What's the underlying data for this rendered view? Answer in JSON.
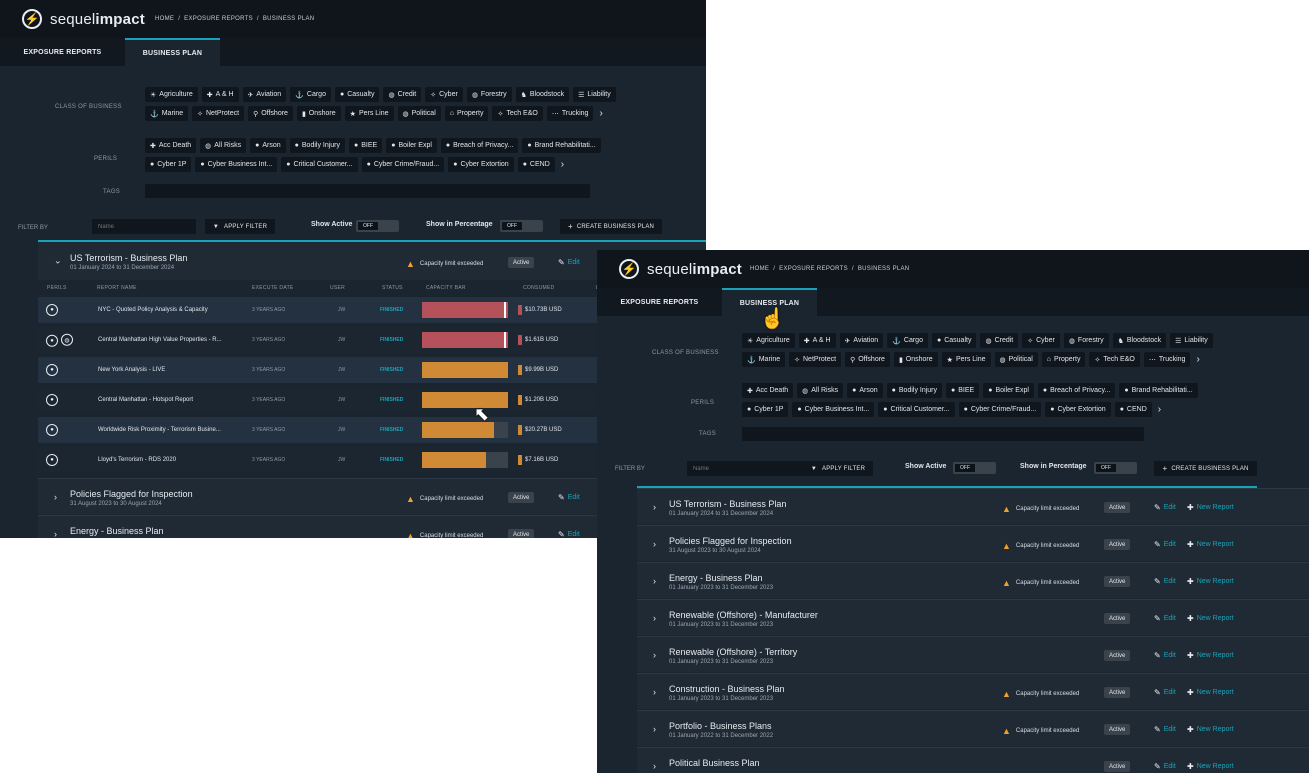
{
  "app": {
    "logo_glyph": "⚡",
    "logo_light": "sequel",
    "logo_bold": "impact",
    "breadcrumb": [
      "HOME",
      "/",
      "EXPOSURE REPORTS",
      "/",
      "BUSINESS PLAN"
    ]
  },
  "tabs": {
    "exposure": "EXPOSURE REPORTS",
    "business": "BUSINESS PLAN"
  },
  "filters": {
    "class_label": "CLASS OF BUSINESS",
    "perils_label": "PERILS",
    "tags_label": "TAGS",
    "classes": [
      {
        "icon": "☀",
        "label": "Agriculture"
      },
      {
        "icon": "✚",
        "label": "A & H"
      },
      {
        "icon": "✈",
        "label": "Aviation"
      },
      {
        "icon": "⚓",
        "label": "Cargo"
      },
      {
        "icon": "●",
        "label": "Casualty"
      },
      {
        "icon": "◍",
        "label": "Credit"
      },
      {
        "icon": "✧",
        "label": "Cyber"
      },
      {
        "icon": "◍",
        "label": "Forestry"
      },
      {
        "icon": "♞",
        "label": "Bloodstock"
      },
      {
        "icon": "☰",
        "label": "Liability"
      },
      {
        "icon": "⚓",
        "label": "Marine"
      },
      {
        "icon": "✧",
        "label": "NetProtect"
      },
      {
        "icon": "⚲",
        "label": "Offshore"
      },
      {
        "icon": "▮",
        "label": "Onshore"
      },
      {
        "icon": "★",
        "label": "Pers Line"
      },
      {
        "icon": "◍",
        "label": "Political"
      },
      {
        "icon": "⌂",
        "label": "Property"
      },
      {
        "icon": "✧",
        "label": "Tech E&O"
      },
      {
        "icon": "⋯",
        "label": "Trucking"
      }
    ],
    "perils": [
      {
        "icon": "✚",
        "label": "Acc Death"
      },
      {
        "icon": "◍",
        "label": "All Risks"
      },
      {
        "icon": "●",
        "label": "Arson"
      },
      {
        "icon": "●",
        "label": "Bodily Injury"
      },
      {
        "icon": "●",
        "label": "BIEE"
      },
      {
        "icon": "●",
        "label": "Boiler Expl"
      },
      {
        "icon": "●",
        "label": "Breach of Privacy..."
      },
      {
        "icon": "●",
        "label": "Brand Rehabilitati..."
      },
      {
        "icon": "●",
        "label": "Cyber 1P"
      },
      {
        "icon": "●",
        "label": "Cyber Business Int..."
      },
      {
        "icon": "●",
        "label": "Critical Customer..."
      },
      {
        "icon": "●",
        "label": "Cyber Crime/Fraud..."
      },
      {
        "icon": "●",
        "label": "Cyber Extortion"
      },
      {
        "icon": "●",
        "label": "CEND"
      }
    ],
    "more_glyph": "›"
  },
  "filterbar": {
    "filter_by": "FILTER BY",
    "name_placeholder": "Name",
    "apply": "APPLY FILTER",
    "show_active": "Show Active",
    "show_pct": "Show in Percentage",
    "off": "OFF",
    "create": "CREATE BUSINESS PLAN",
    "filter_glyph": "▼",
    "plus_glyph": "+"
  },
  "labels": {
    "capacity_exceeded": "Capacity limit exceeded",
    "active": "Active",
    "edit": "Edit",
    "new_report": "New Report",
    "warn_glyph": "▲",
    "edit_glyph": "✎",
    "plus_glyph": "✚",
    "chev_right": "›",
    "chev_down": "⌄"
  },
  "table": {
    "headers": [
      "PERILS",
      "REPORT NAME",
      "EXECUTE DATE",
      "USER",
      "STATUS",
      "CAPACITY BAR",
      "CONSUMED",
      "L"
    ],
    "rows": [
      {
        "name": "NYC - Quoted Policy Analysis & Capacity",
        "date": "3 YEARS AGO",
        "user": "JW",
        "status": "FINISHED",
        "consumed": "$10.73B USD",
        "fill": 1.0,
        "color": "#b5515b",
        "mark": 0.95,
        "perils": [
          "●"
        ]
      },
      {
        "name": "Central Manhattan High Value Properties - R...",
        "date": "3 YEARS AGO",
        "user": "JW",
        "status": "FINISHED",
        "consumed": "$1.61B USD",
        "fill": 1.0,
        "color": "#b5515b",
        "mark": 0.95,
        "perils": [
          "●",
          "◍"
        ]
      },
      {
        "name": "New York Analysis - LIVE",
        "date": "3 YEARS AGO",
        "user": "JW",
        "status": "FINISHED",
        "consumed": "$9.99B USD",
        "fill": 1.0,
        "color": "#d08a35",
        "mark": null,
        "perils": [
          "●"
        ]
      },
      {
        "name": "Central Manhattan - Hotspot Report",
        "date": "3 YEARS AGO",
        "user": "JW",
        "status": "FINISHED",
        "consumed": "$1.20B USD",
        "fill": 1.0,
        "color": "#d08a35",
        "mark": null,
        "perils": [
          "●"
        ]
      },
      {
        "name": "Worldwide Risk Proximity - Terrorism Busine...",
        "date": "3 YEARS AGO",
        "user": "JW",
        "status": "FINISHED",
        "consumed": "$20.27B USD",
        "fill": 0.84,
        "color": "#d08a35",
        "mark": null,
        "perils": [
          "●"
        ]
      },
      {
        "name": "Lloyd's Terrorism - RDS 2020",
        "date": "3 YEARS AGO",
        "user": "JW",
        "status": "FINISHED",
        "consumed": "$7.16B USD",
        "fill": 0.74,
        "color": "#d08a35",
        "mark": null,
        "perils": [
          "●"
        ]
      }
    ]
  },
  "w1_plans": [
    {
      "title": "US Terrorism - Business Plan",
      "dates": "01 January 2024  to  31 December 2024",
      "warn": true
    },
    {
      "title": "Policies Flagged for Inspection",
      "dates": "31 August 2023  to  30 August 2024",
      "warn": true
    },
    {
      "title": "Energy - Business Plan",
      "dates": "01 January 2023  to  31 December 2023",
      "warn": true
    }
  ],
  "w2_plans": [
    {
      "title": "US Terrorism - Business Plan",
      "dates": "01 January 2024  to  31 December 2024",
      "warn": true
    },
    {
      "title": "Policies Flagged for Inspection",
      "dates": "31 August 2023  to  30 August 2024",
      "warn": true
    },
    {
      "title": "Energy - Business Plan",
      "dates": "01 January 2023  to  31 December 2023",
      "warn": true
    },
    {
      "title": "Renewable (Offshore) - Manufacturer",
      "dates": "01 January 2023  to  31 December 2023",
      "warn": false
    },
    {
      "title": "Renewable (Offshore) - Territory",
      "dates": "01 January 2023  to  31 December 2023",
      "warn": false
    },
    {
      "title": "Construction - Business Plan",
      "dates": "01 January 2023  to  31 December 2023",
      "warn": true
    },
    {
      "title": "Portfolio - Business Plans",
      "dates": "01 January 2022  to  31 December 2022",
      "warn": true
    },
    {
      "title": "Political Business Plan",
      "dates": "",
      "warn": false
    }
  ]
}
